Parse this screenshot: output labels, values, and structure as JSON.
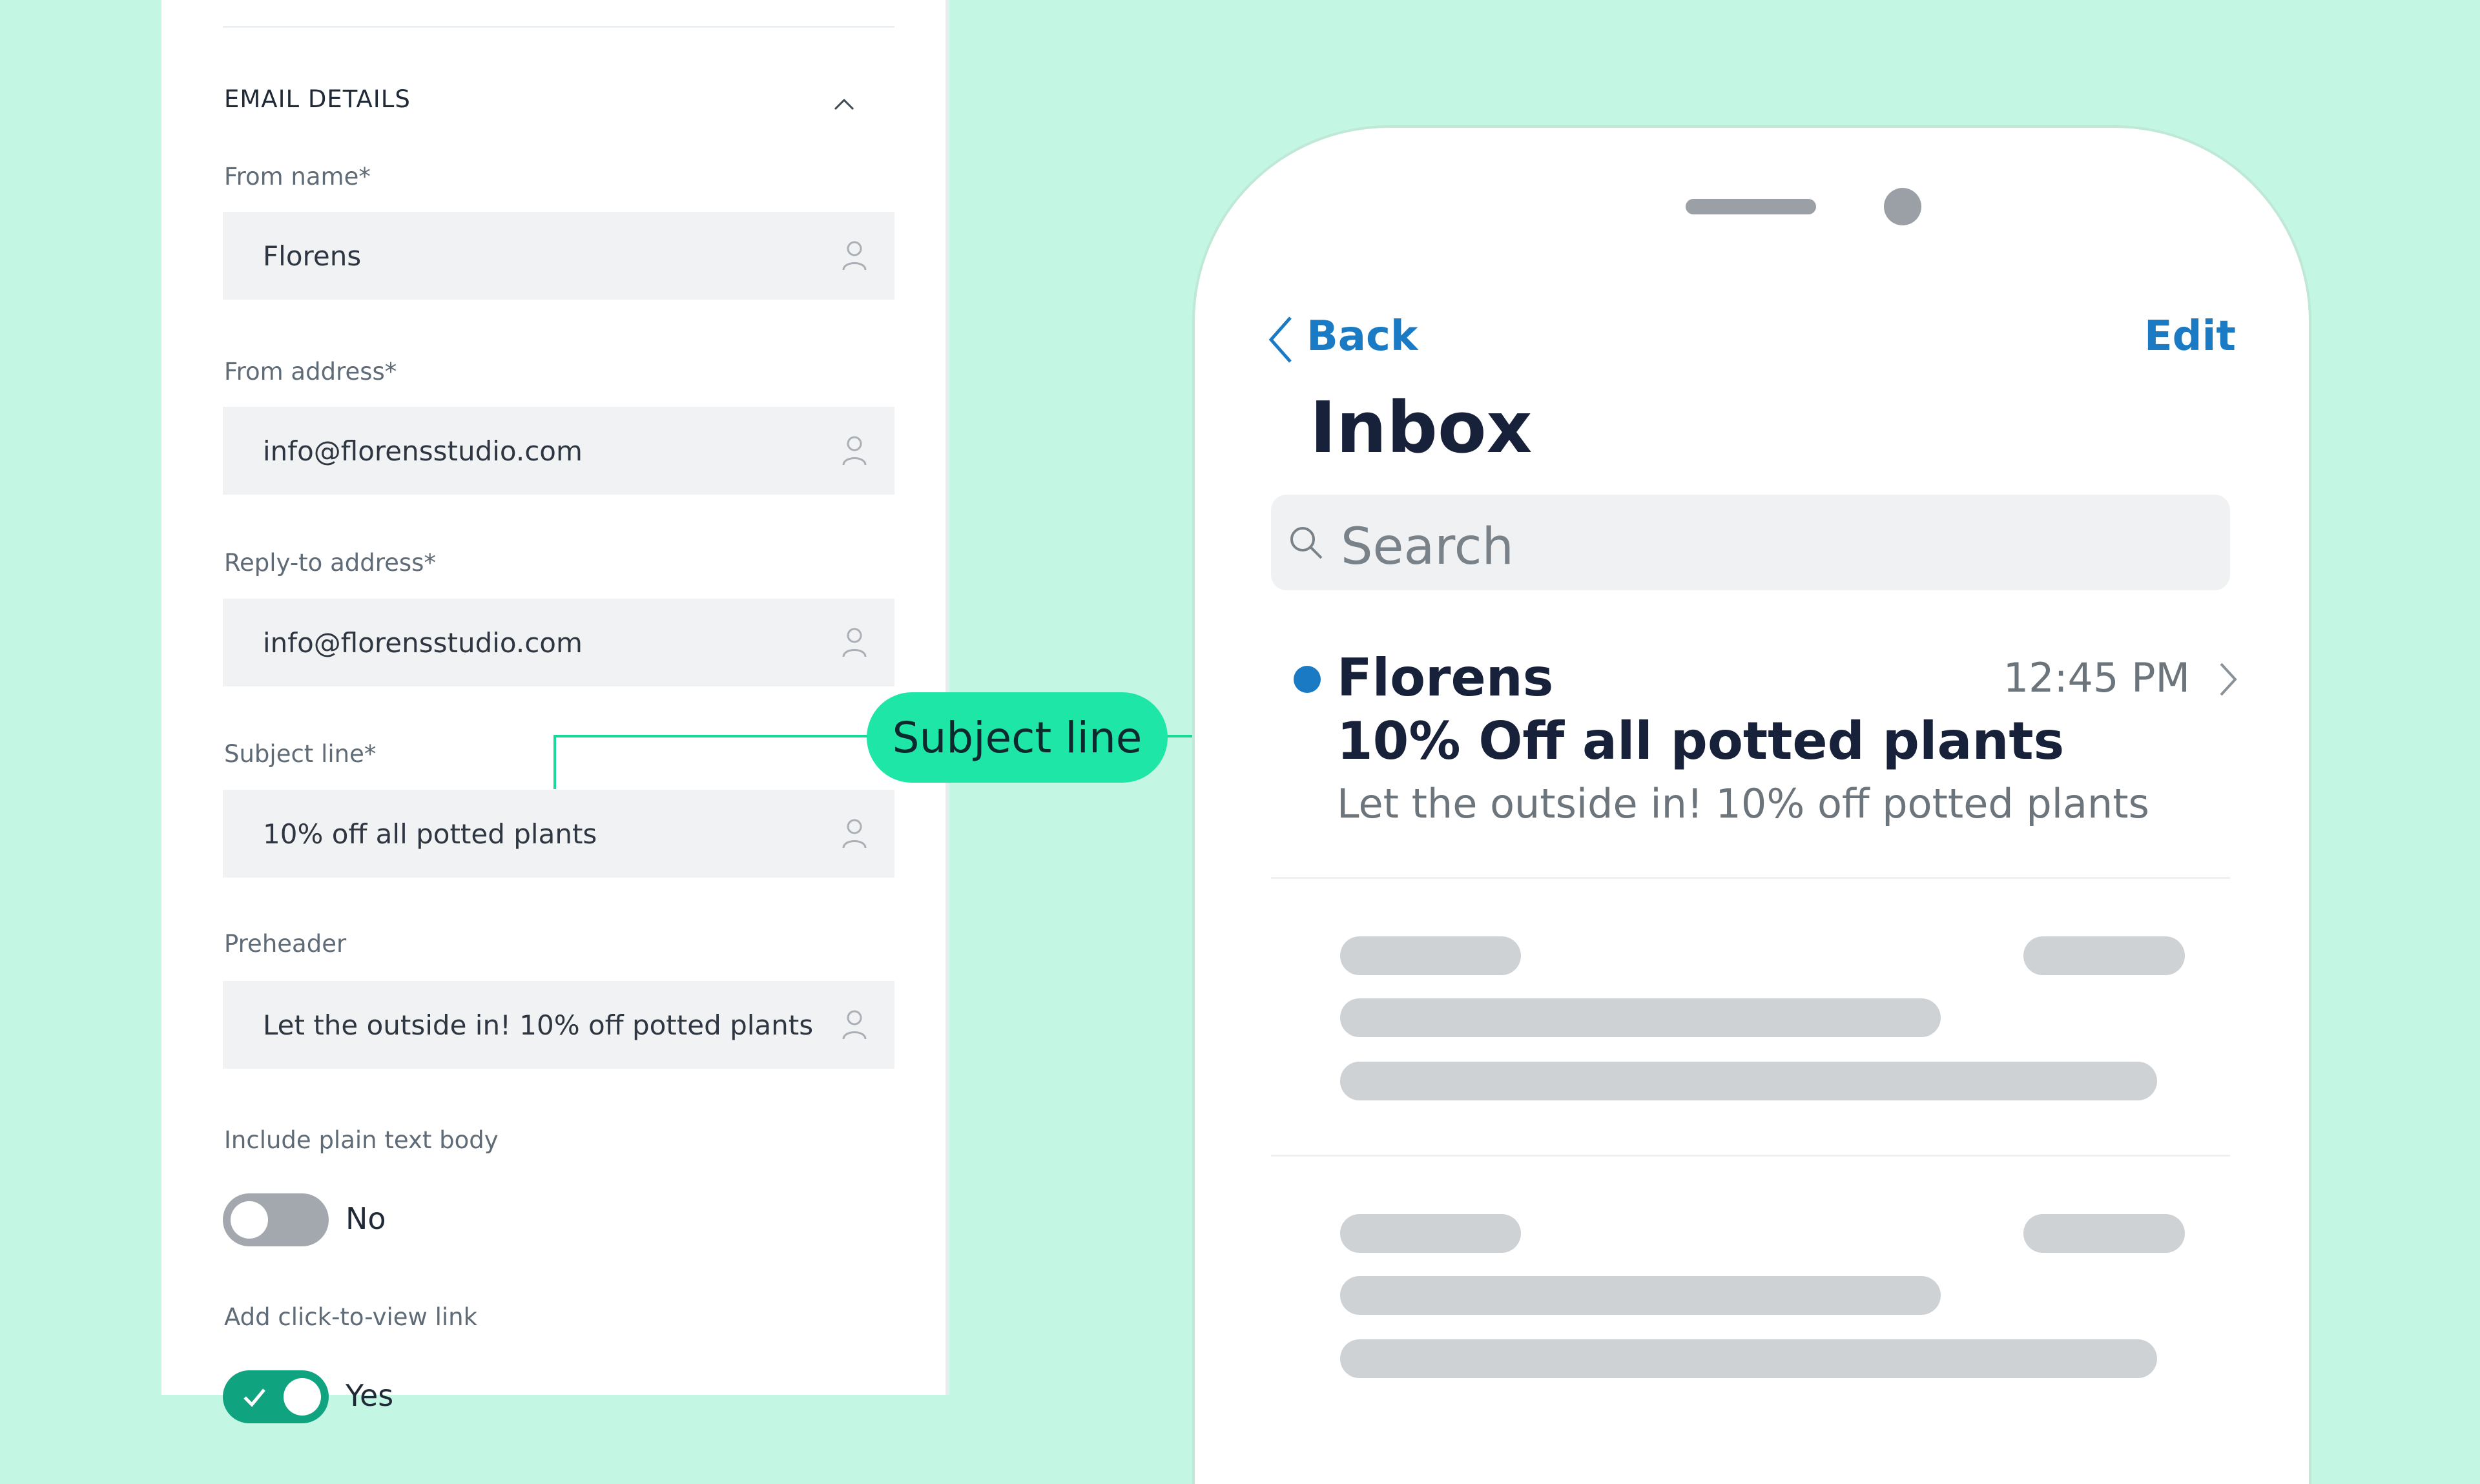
{
  "settings": {
    "section_title": "EMAIL DETAILS",
    "fields": {
      "from_name": {
        "label": "From name*",
        "value": "Florens"
      },
      "from_address": {
        "label": "From address*",
        "value": "info@florensstudio.com"
      },
      "reply_to": {
        "label": "Reply-to address*",
        "value": "info@florensstudio.com"
      },
      "subject": {
        "label": "Subject line*",
        "value": "10% off all potted plants"
      },
      "preheader": {
        "label": "Preheader",
        "value": "Let the outside in! 10% off potted plants"
      }
    },
    "plain_text": {
      "label": "Include plain text body",
      "value": "No"
    },
    "click_to_view": {
      "label": "Add click-to-view link",
      "value": "Yes"
    }
  },
  "callout": {
    "label": "Subject line"
  },
  "phone": {
    "back_label": "Back",
    "edit_label": "Edit",
    "title": "Inbox",
    "search_placeholder": "Search",
    "message": {
      "sender": "Florens",
      "time": "12:45 PM",
      "subject": "10% Off all potted plants",
      "preview": "Let the outside in! 10% off potted plants"
    }
  },
  "colors": {
    "background": "#c4f7e3",
    "accent_green": "#1de6a6",
    "link_blue": "#1a7bc4",
    "toggle_on": "#10a37f",
    "toggle_off": "#a2a8ad"
  }
}
